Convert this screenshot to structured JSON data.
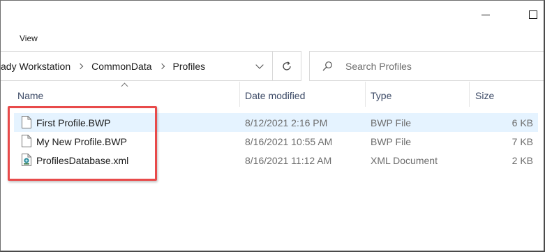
{
  "ribbon": {
    "tabs": [
      {
        "label": "View"
      }
    ]
  },
  "address": {
    "crumbs": [
      "ady Workstation",
      "CommonData",
      "Profiles"
    ]
  },
  "search": {
    "placeholder": "Search Profiles"
  },
  "columns": {
    "name": "Name",
    "date": "Date modified",
    "type": "Type",
    "size": "Size"
  },
  "files": [
    {
      "name": "First Profile.BWP",
      "date": "8/12/2021 2:16 PM",
      "type": "BWP File",
      "size": "6 KB",
      "icon": "generic-file-icon",
      "selected": true
    },
    {
      "name": "My New Profile.BWP",
      "date": "8/16/2021 10:55 AM",
      "type": "BWP File",
      "size": "7 KB",
      "icon": "generic-file-icon",
      "selected": false
    },
    {
      "name": "ProfilesDatabase.xml",
      "date": "8/16/2021 11:12 AM",
      "type": "XML Document",
      "size": "2 KB",
      "icon": "xml-file-icon",
      "selected": false
    }
  ],
  "colors": {
    "highlight": "#e84a4a",
    "selection": "#e5f3ff",
    "header_text": "#3c4a66"
  }
}
